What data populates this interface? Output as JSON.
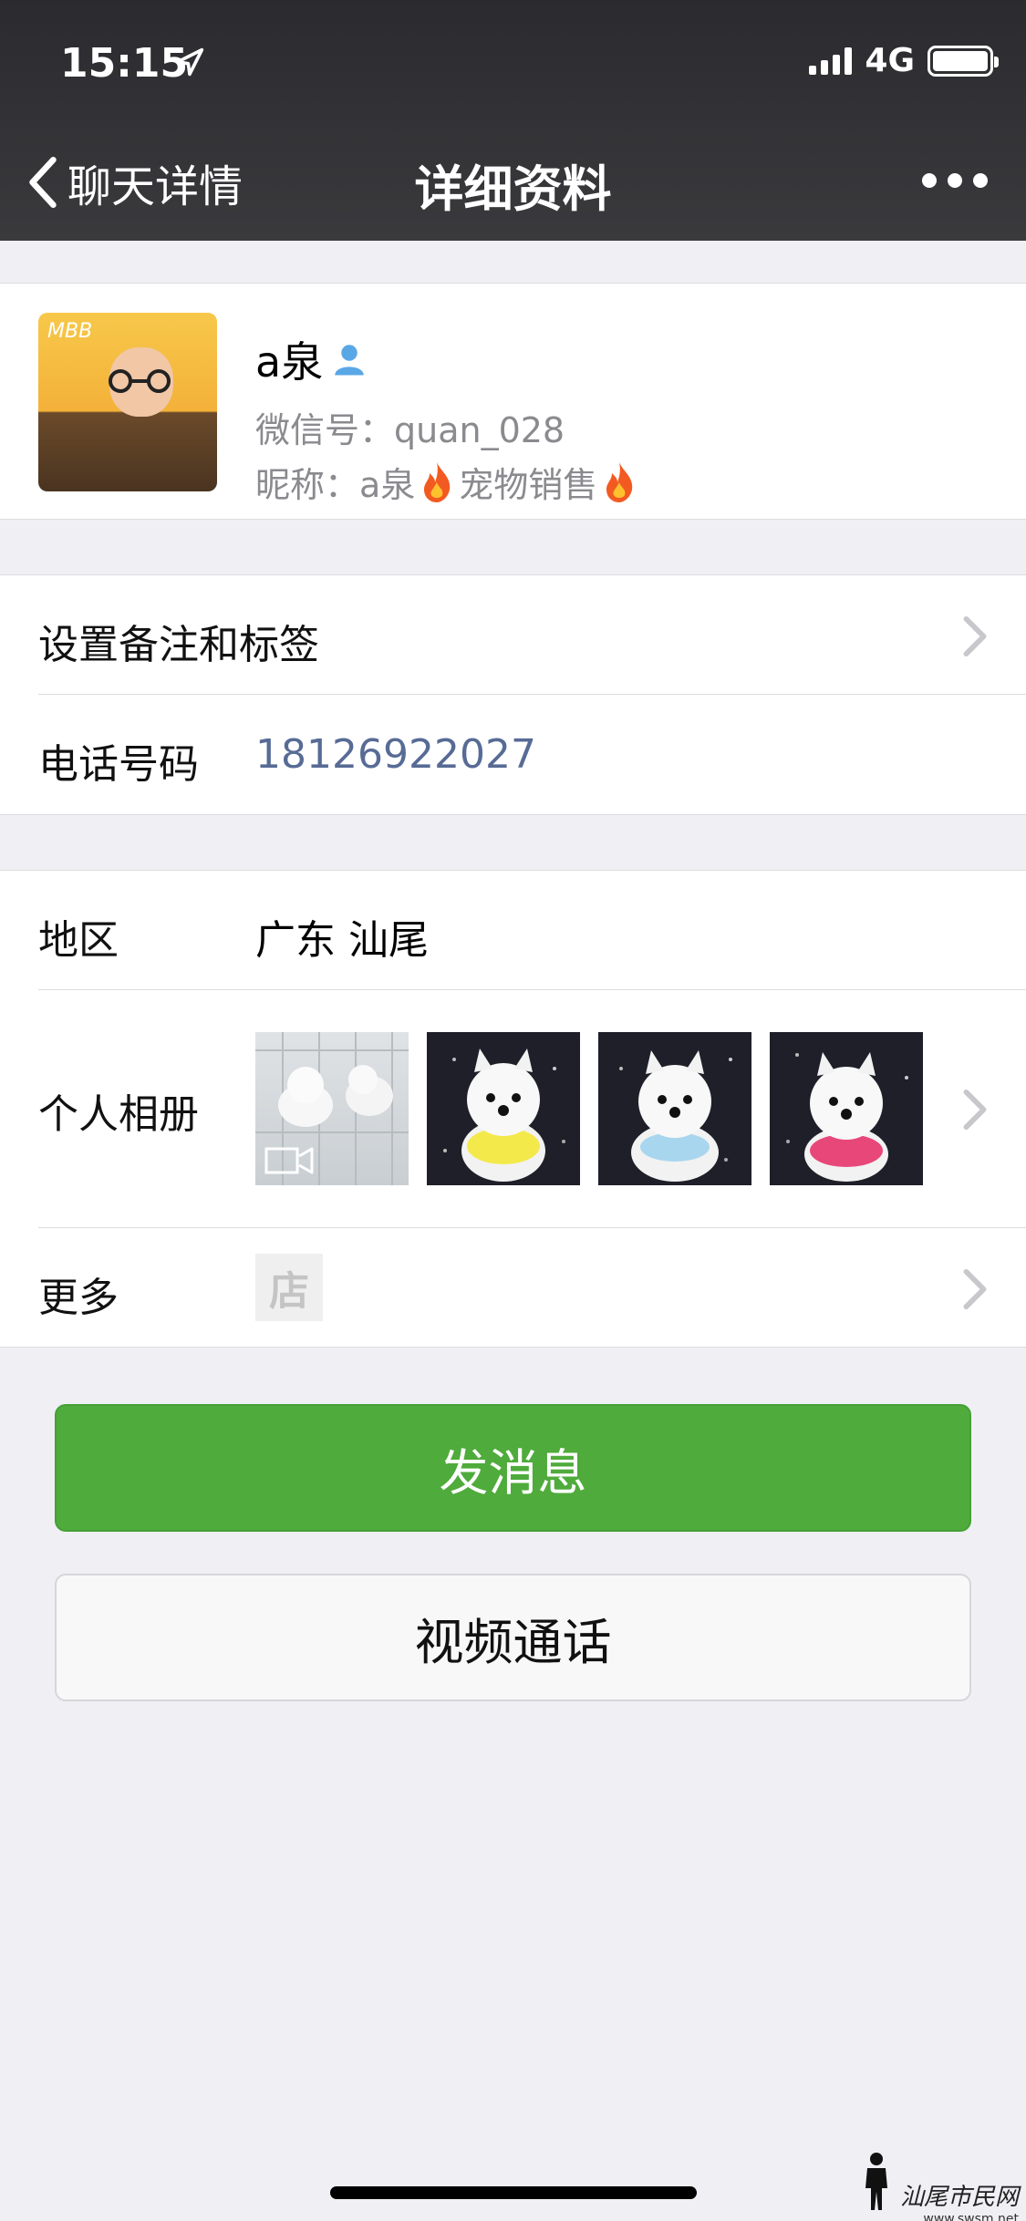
{
  "status": {
    "time": "15:15",
    "network": "4G"
  },
  "nav": {
    "back_label": "聊天详情",
    "title": "详细资料"
  },
  "profile": {
    "name": "a泉",
    "wechat_id": "微信号：quan_028",
    "nickname_prefix": "昵称：a泉",
    "nickname_middle": "宠物销售",
    "avatar_logo": "MBB"
  },
  "rows": {
    "remark_label": "设置备注和标签",
    "phone_label": "电话号码",
    "phone_value": "18126922027",
    "region_label": "地区",
    "region_value": "广东 汕尾",
    "album_label": "个人相册",
    "more_label": "更多",
    "shop_icon_char": "店"
  },
  "buttons": {
    "message": "发消息",
    "video_call": "视频通话"
  },
  "watermark": {
    "text": "汕尾市民网",
    "url": "www.swsm.net"
  },
  "colors": {
    "accent_green": "#4fab3b",
    "phone_blue": "#576b95",
    "nav_bg": "#2f2f32"
  }
}
